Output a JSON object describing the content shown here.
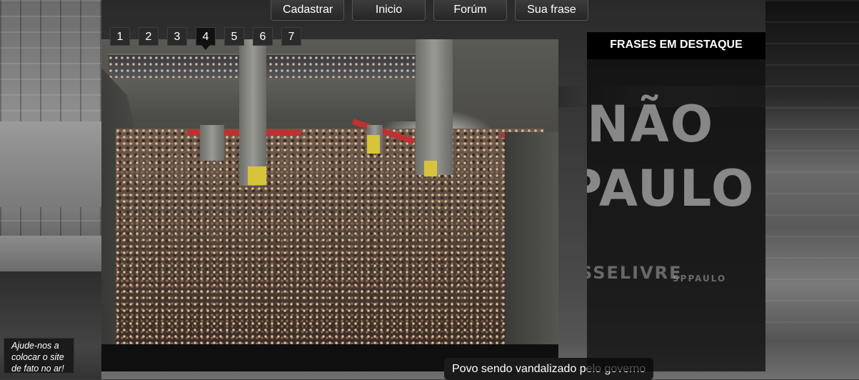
{
  "nav": {
    "items": [
      "Cadastrar",
      "Inicio",
      "Forúm",
      "Sua frase"
    ]
  },
  "slider": {
    "pages": [
      "1",
      "2",
      "3",
      "4",
      "5",
      "6",
      "7"
    ],
    "active_page": "4",
    "caption": "Povo sendo vandalizado pelo governo"
  },
  "sidebar": {
    "title": "FRASES EM DESTAQUE"
  },
  "background_text": {
    "line1": "NÃO",
    "line2": "PAULO",
    "line3": "SSELIVRE",
    "line4": "SPPAULO"
  },
  "help": {
    "text": "Ajude-nos a colocar o site de fato no ar!"
  }
}
